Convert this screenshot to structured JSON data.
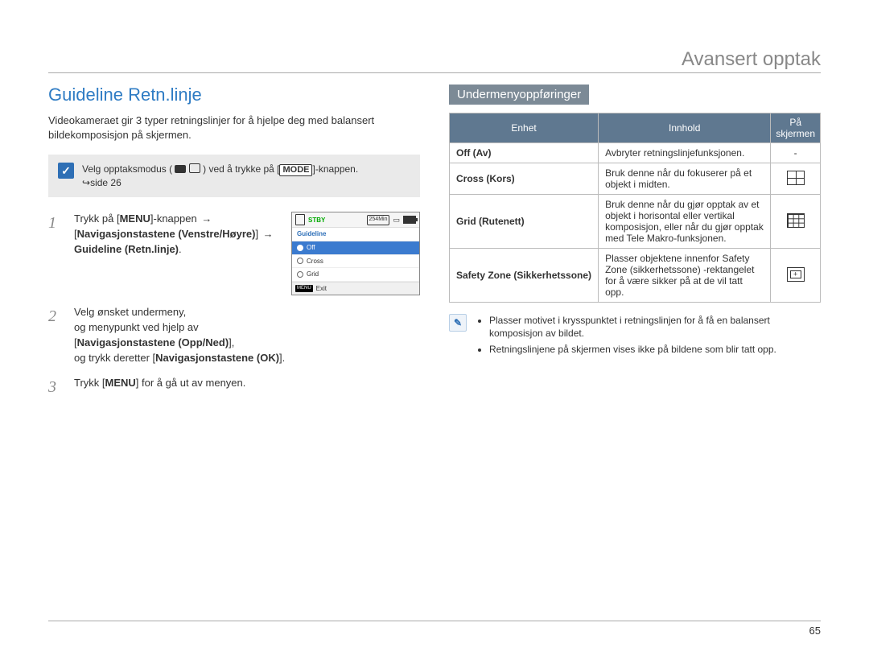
{
  "chapter_title": "Avansert opptak",
  "section_title": "Guideline Retn.linje",
  "intro": "Videokameraet gir 3 typer retningslinjer for å hjelpe deg med balansert bildekomposisjon på skjermen.",
  "note1_pre": "Velg opptaksmodus (",
  "note1_mid": ") ved å trykke på [",
  "note1_btn": "MODE",
  "note1_post": "]-knappen.",
  "note1_page": "side 26",
  "steps": [
    {
      "pre": "Trykk på [",
      "btn": "MENU",
      "post_a": "]-knappen",
      "bold_nav": "Navigasjonstastene (Venstre/Høyre)",
      "bold_target": "Guideline (Retn.linje)"
    },
    {
      "line1": "Velg ønsket undermeny,",
      "line2_pre": "og menypunkt ved hjelp av",
      "bold_nav": "Navigasjonstastene (Opp/Ned)",
      "line3_pre": "og trykk deretter",
      "bold_ok": "Navigasjonstastene (OK)"
    },
    {
      "pre": "Trykk [",
      "btn": "MENU",
      "post": "] for å gå ut av menyen."
    }
  ],
  "lcd": {
    "stby": "STBY",
    "time": "254Min",
    "title": "Guideline",
    "items": [
      "Off",
      "Cross",
      "Grid"
    ],
    "selected_index": 0,
    "exit": "Exit",
    "menu_tag": "MENU"
  },
  "submenu_title": "Undermenyoppføringer",
  "table": {
    "headers": [
      "Enhet",
      "Innhold",
      "På skjermen"
    ],
    "rows": [
      {
        "unit": "Off (Av)",
        "desc": "Avbryter retningslinjefunksjonen.",
        "sym": "dash"
      },
      {
        "unit": "Cross (Kors)",
        "desc": "Bruk denne når du fokuserer på et objekt i midten.",
        "sym": "cross"
      },
      {
        "unit": "Grid (Rutenett)",
        "desc": "Bruk denne når du gjør opptak av et objekt i horisontal eller vertikal komposisjon, eller når du gjør opptak med Tele Makro-funksjonen.",
        "sym": "grid"
      },
      {
        "unit": "Safety Zone (Sikkerhetssone)",
        "desc": "Plasser objektene innenfor Safety Zone (sikkerhetssone) -rektangelet for å være sikker på at de vil tatt opp.",
        "sym": "safe"
      }
    ]
  },
  "notes": [
    "Plasser motivet i krysspunktet i retningslinjen for å få en balansert komposisjon av bildet.",
    "Retningslinjene på skjermen vises ikke på bildene som blir tatt opp."
  ],
  "page_number": "65"
}
